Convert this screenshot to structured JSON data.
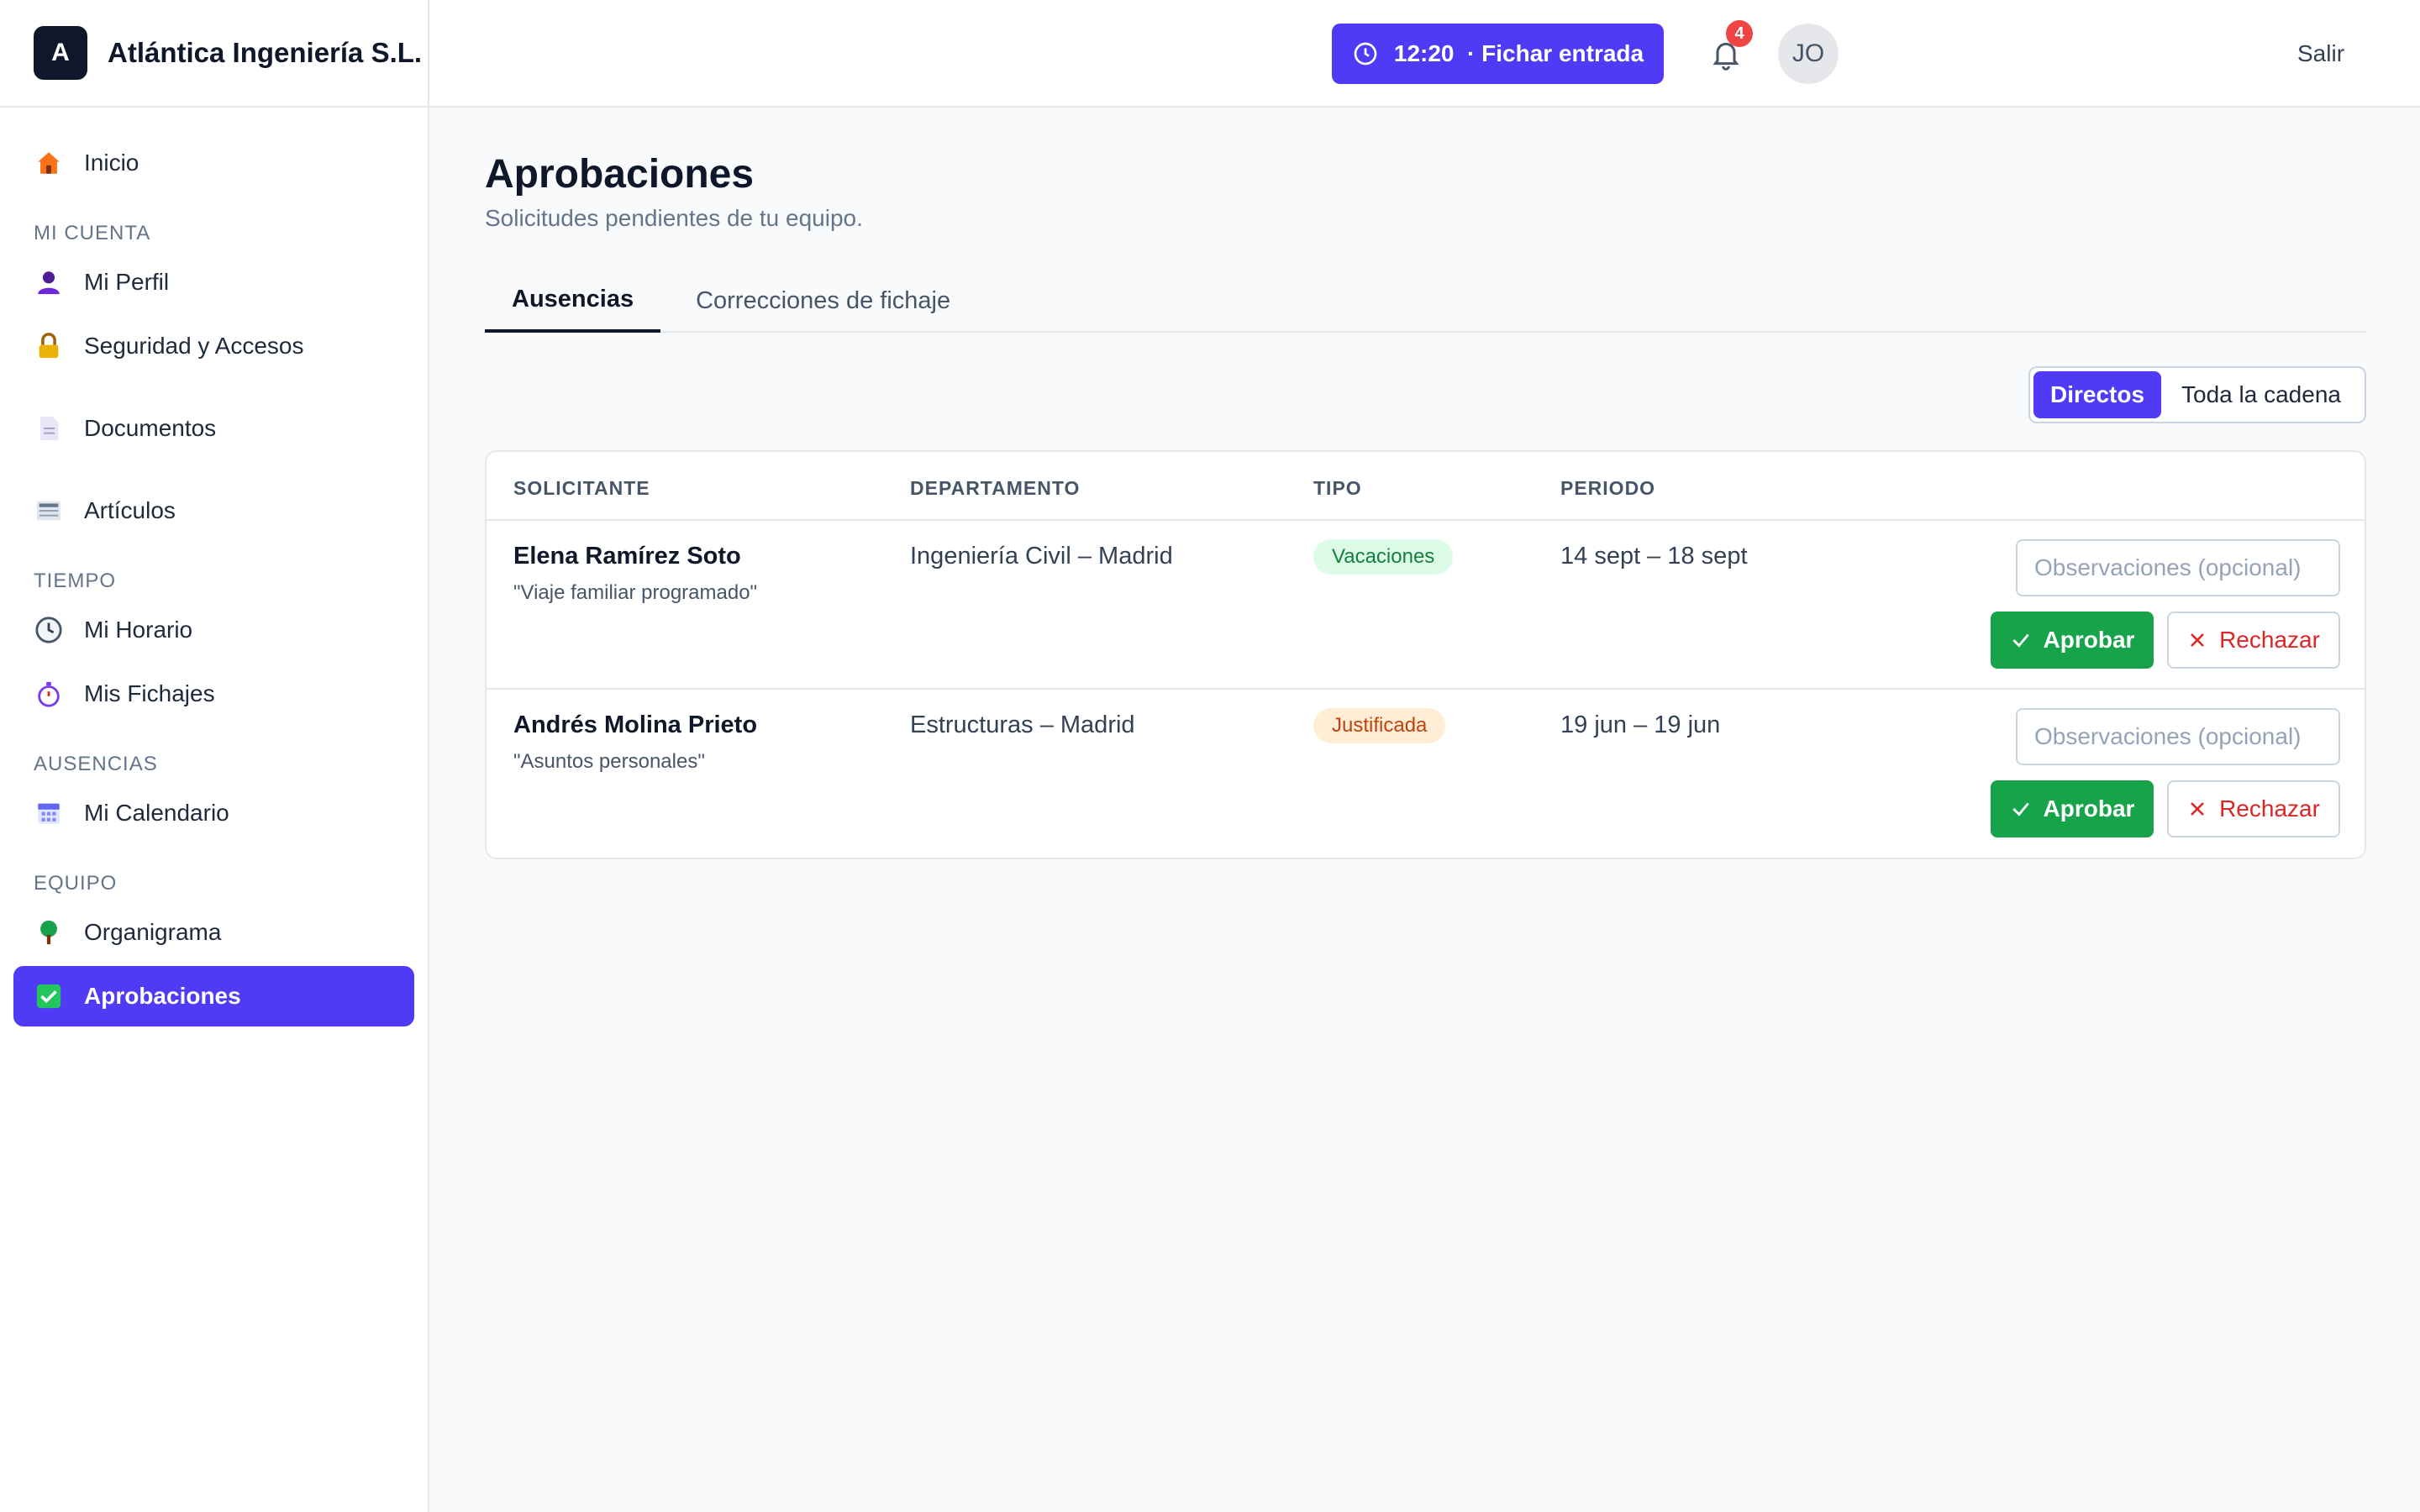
{
  "brand": {
    "logo_letter": "A",
    "name": "Atlántica Ingeniería S.L."
  },
  "sidebar": {
    "items": [
      {
        "label": "Inicio",
        "icon": "home-icon"
      },
      {
        "section": "MI CUENTA"
      },
      {
        "label": "Mi Perfil",
        "icon": "user-icon"
      },
      {
        "label": "Seguridad y Accesos",
        "icon": "lock-icon"
      },
      {
        "label": "Documentos",
        "icon": "document-icon"
      },
      {
        "label": "Artículos",
        "icon": "newspaper-icon"
      },
      {
        "section": "TIEMPO"
      },
      {
        "label": "Mi Horario",
        "icon": "clock-icon"
      },
      {
        "label": "Mis Fichajes",
        "icon": "stopwatch-icon"
      },
      {
        "section": "AUSENCIAS"
      },
      {
        "label": "Mi Calendario",
        "icon": "calendar-icon"
      },
      {
        "section": "EQUIPO"
      },
      {
        "label": "Organigrama",
        "icon": "tree-icon"
      },
      {
        "label": "Aprobaciones",
        "icon": "checkbox-icon",
        "active": true
      }
    ]
  },
  "header": {
    "clock_label": "12:20  · Fichar entrada",
    "notifications_count": "4",
    "avatar_initials": "JO",
    "logout_label": "Salir"
  },
  "page": {
    "title": "Aprobaciones",
    "subtitle": "Solicitudes pendientes de tu equipo."
  },
  "tabs": [
    {
      "label": "Ausencias",
      "active": true
    },
    {
      "label": "Correcciones de fichaje",
      "active": false
    }
  ],
  "scope_toggle": {
    "direct": "Directos",
    "chain": "Toda la cadena",
    "selected": "Directos"
  },
  "table": {
    "headers": [
      "SOLICITANTE",
      "DEPARTAMENTO",
      "TIPO",
      "PERIODO"
    ],
    "rows": [
      {
        "name": "Elena Ramírez Soto",
        "note": "\"Viaje familiar programado\"",
        "department": "Ingeniería Civil – Madrid",
        "type": "Vacaciones",
        "period": "14 sept – 18 sept",
        "obs_placeholder": "Observaciones (opcional)",
        "approve": "Aprobar",
        "reject": "Rechazar"
      },
      {
        "name": "Andrés Molina Prieto",
        "note": "\"Asuntos personales\"",
        "department": "Estructuras – Madrid",
        "type": "Justificada",
        "period": "19 jun – 19 jun",
        "obs_placeholder": "Observaciones (opcional)",
        "approve": "Aprobar",
        "reject": "Rechazar"
      }
    ]
  },
  "colors": {
    "accent": "#4f3bf6",
    "approve": "#16a34a",
    "reject": "#dc2626",
    "badge_alert": "#ef4444"
  }
}
